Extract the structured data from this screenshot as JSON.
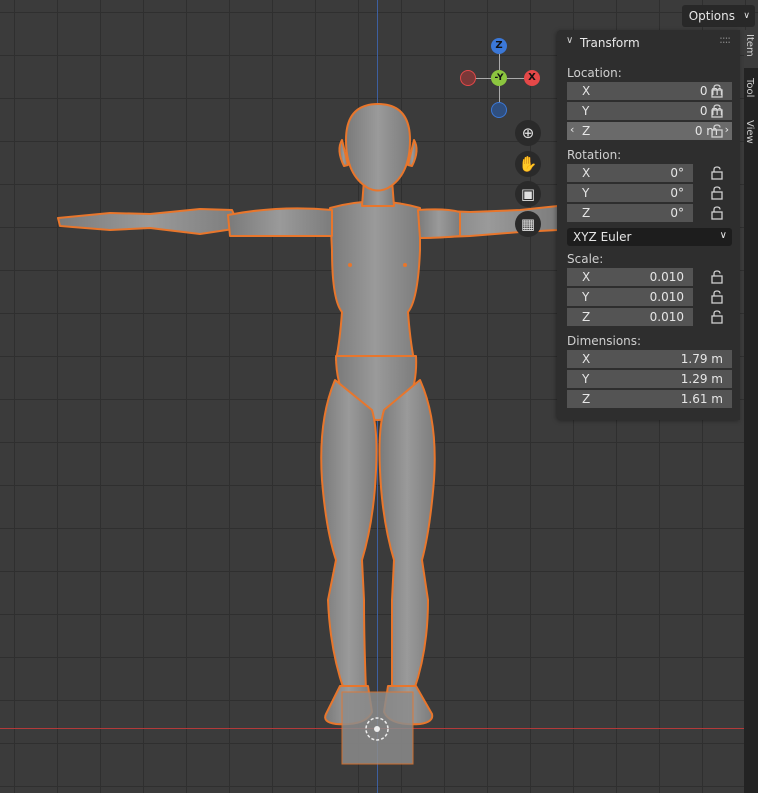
{
  "header": {
    "options_label": "Options"
  },
  "gizmo": {
    "z_label": "Z",
    "y_label": "-Y",
    "x_label": "X",
    "colors": {
      "x": "#e54848",
      "y": "#8cc63f",
      "z": "#3b78d8"
    }
  },
  "navigation": {
    "icons": [
      "zoom-icon",
      "hand-pan-icon",
      "camera-icon",
      "grid-icon"
    ]
  },
  "panel": {
    "title": "Transform",
    "location": {
      "label": "Location:",
      "x": {
        "axis": "X",
        "value": "0 m"
      },
      "y": {
        "axis": "Y",
        "value": "0 m"
      },
      "z": {
        "axis": "Z",
        "value": "0 m"
      }
    },
    "rotation": {
      "label": "Rotation:",
      "x": {
        "axis": "X",
        "value": "0°"
      },
      "y": {
        "axis": "Y",
        "value": "0°"
      },
      "z": {
        "axis": "Z",
        "value": "0°"
      },
      "mode": "XYZ Euler"
    },
    "scale": {
      "label": "Scale:",
      "x": {
        "axis": "X",
        "value": "0.010"
      },
      "y": {
        "axis": "Y",
        "value": "0.010"
      },
      "z": {
        "axis": "Z",
        "value": "0.010"
      }
    },
    "dimensions": {
      "label": "Dimensions:",
      "x": {
        "axis": "X",
        "value": "1.79 m"
      },
      "y": {
        "axis": "Y",
        "value": "1.29 m"
      },
      "z": {
        "axis": "Z",
        "value": "1.61 m"
      }
    }
  },
  "tabs": [
    "Item",
    "Tool",
    "View"
  ],
  "theme": {
    "selection_outline": "#e8762c",
    "model_fill": "#8e8e8e"
  }
}
